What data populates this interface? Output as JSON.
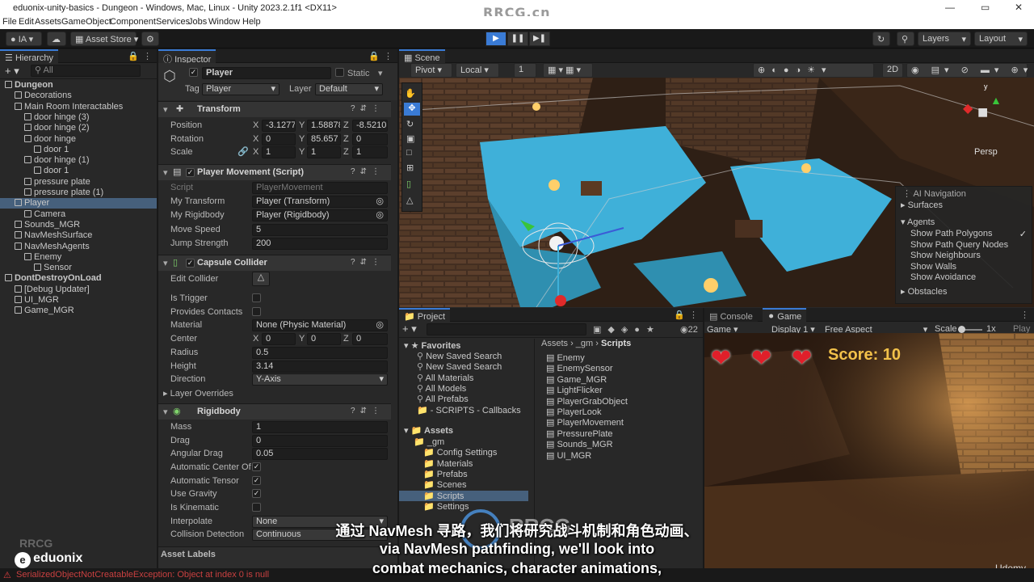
{
  "window": {
    "title": "eduonix-unity-basics - Dungeon - Windows, Mac, Linux - Unity 2023.2.1f1 <DX11>",
    "watermark": "RRCG.cn"
  },
  "menu": [
    "File",
    "Edit",
    "Assets",
    "GameObject",
    "Component",
    "Services",
    "Jobs",
    "Window",
    "Help"
  ],
  "toolbar": {
    "account": "IA",
    "asset_store": "Asset Store",
    "layers": "Layers",
    "layout": "Layout"
  },
  "hierarchy": {
    "tab": "Hierarchy",
    "search_placeholder": "All",
    "items": [
      {
        "label": "Dungeon",
        "depth": 0
      },
      {
        "label": "Decorations",
        "depth": 1
      },
      {
        "label": "Main Room Interactables",
        "depth": 1
      },
      {
        "label": "door hinge (3)",
        "depth": 2
      },
      {
        "label": "door hinge (2)",
        "depth": 2
      },
      {
        "label": "door hinge",
        "depth": 2
      },
      {
        "label": "door 1",
        "depth": 3
      },
      {
        "label": "door hinge (1)",
        "depth": 2
      },
      {
        "label": "door 1",
        "depth": 3
      },
      {
        "label": "pressure plate",
        "depth": 2
      },
      {
        "label": "pressure plate (1)",
        "depth": 2
      },
      {
        "label": "Player",
        "depth": 1,
        "selected": true
      },
      {
        "label": "Camera",
        "depth": 2
      },
      {
        "label": "Sounds_MGR",
        "depth": 1
      },
      {
        "label": "NavMeshSurface",
        "depth": 1
      },
      {
        "label": "NavMeshAgents",
        "depth": 1
      },
      {
        "label": "Enemy",
        "depth": 2
      },
      {
        "label": "Sensor",
        "depth": 3
      },
      {
        "label": "DontDestroyOnLoad",
        "depth": 0
      },
      {
        "label": "[Debug Updater]",
        "depth": 1
      },
      {
        "label": "UI_MGR",
        "depth": 1
      },
      {
        "label": "Game_MGR",
        "depth": 1
      }
    ]
  },
  "inspector": {
    "tab": "Inspector",
    "object_name": "Player",
    "static_label": "Static",
    "tag_label": "Tag",
    "tag_value": "Player",
    "layer_label": "Layer",
    "layer_value": "Default",
    "transform": {
      "title": "Transform",
      "position_label": "Position",
      "position": [
        "-3.1277",
        "1.58878",
        "-8.5210"
      ],
      "rotation_label": "Rotation",
      "rotation": [
        "0",
        "85.657",
        "0"
      ],
      "scale_label": "Scale",
      "scale": [
        "1",
        "1",
        "1"
      ]
    },
    "player_movement": {
      "title": "Player Movement (Script)",
      "script_label": "Script",
      "script_value": "PlayerMovement",
      "my_transform_label": "My Transform",
      "my_transform_value": "Player (Transform)",
      "my_rigidbody_label": "My Rigidbody",
      "my_rigidbody_value": "Player (Rigidbody)",
      "move_speed_label": "Move Speed",
      "move_speed_value": "5",
      "jump_strength_label": "Jump Strength",
      "jump_strength_value": "200"
    },
    "capsule_collider": {
      "title": "Capsule Collider",
      "edit_collider_label": "Edit Collider",
      "is_trigger_label": "Is Trigger",
      "provides_contacts_label": "Provides Contacts",
      "material_label": "Material",
      "material_value": "None (Physic Material)",
      "center_label": "Center",
      "center": [
        "0",
        "0",
        "0"
      ],
      "radius_label": "Radius",
      "radius_value": "0.5",
      "height_label": "Height",
      "height_value": "3.14",
      "direction_label": "Direction",
      "direction_value": "Y-Axis",
      "layer_overrides_label": "Layer Overrides"
    },
    "rigidbody": {
      "title": "Rigidbody",
      "mass_label": "Mass",
      "mass_value": "1",
      "drag_label": "Drag",
      "drag_value": "0",
      "angular_drag_label": "Angular Drag",
      "angular_drag_value": "0.05",
      "auto_center_label": "Automatic Center Of",
      "auto_tensor_label": "Automatic Tensor",
      "use_gravity_label": "Use Gravity",
      "is_kinematic_label": "Is Kinematic",
      "interpolate_label": "Interpolate",
      "interpolate_value": "None",
      "collision_label": "Collision Detection",
      "collision_value": "Continuous"
    },
    "asset_labels": "Asset Labels"
  },
  "scene": {
    "tab": "Scene",
    "pivot": "Pivot",
    "local": "Local",
    "grid_value": "1",
    "mode_2d": "2D",
    "persp": "Persp",
    "overlay": {
      "title": "AI Navigation",
      "surfaces": "Surfaces",
      "agents": "Agents",
      "options": [
        "Show Path Polygons",
        "Show Path Query Nodes",
        "Show Neighbours",
        "Show Walls",
        "Show Avoidance"
      ],
      "obstacles": "Obstacles"
    }
  },
  "project": {
    "tab": "Project",
    "hidden_count": "22",
    "favorites_label": "Favorites",
    "favorites": [
      "New Saved Search",
      "New Saved Search",
      "All Materials",
      "All Models",
      "All Prefabs",
      "- SCRIPTS - Callbacks"
    ],
    "assets_label": "Assets",
    "tree": [
      "_gm",
      "Config Settings",
      "Materials",
      "Prefabs",
      "Scenes",
      "Scripts",
      "Settings"
    ],
    "breadcrumb": [
      "Assets",
      "_gm",
      "Scripts"
    ],
    "files": [
      "Enemy",
      "EnemySensor",
      "Game_MGR",
      "LightFlicker",
      "PlayerGrabObject",
      "PlayerLook",
      "PlayerMovement",
      "PressurePlate",
      "Sounds_MGR",
      "UI_MGR"
    ]
  },
  "console_tab": "Console",
  "game": {
    "tab": "Game",
    "display_mode": "Game",
    "display": "Display 1",
    "aspect": "Free Aspect",
    "scale_label": "Scale",
    "scale_value": "1x",
    "play_label": "Play",
    "score_text": "Score: 10",
    "hearts": 3
  },
  "status_error": "SerializedObjectNotCreatableException: Object at index 0 is null",
  "overlay_brand": {
    "eduonix": "eduonix",
    "udemy": "Udemy",
    "rrcg": "RRCG"
  },
  "subtitles": {
    "line1": "通过 NavMesh 寻路，我们将研究战斗机制和角色动画、",
    "line2": "via NavMesh pathfinding, we'll look into",
    "line3": "combat mechanics, character animations,"
  },
  "colors": {
    "accent": "#3a7bd5",
    "navmesh": "#3fb0d9",
    "score": "#f2c14a",
    "heart": "#e01f2a"
  }
}
